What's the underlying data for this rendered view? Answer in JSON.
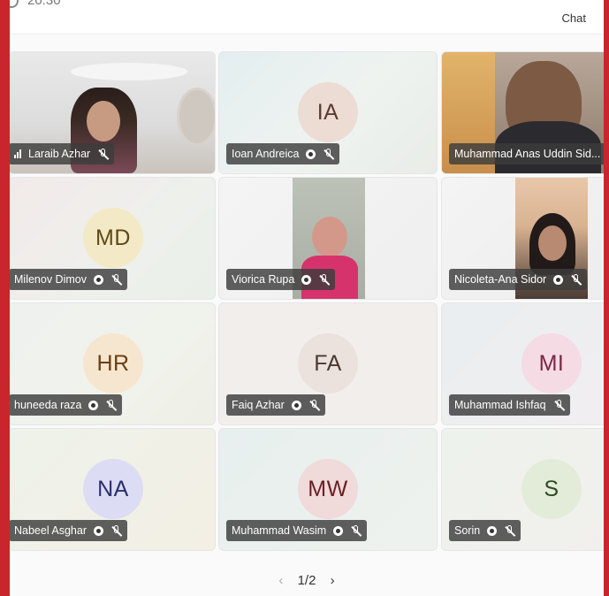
{
  "header": {
    "time": "20:30",
    "chat_label": "Chat"
  },
  "participants": [
    {
      "name": "Laraib Azhar",
      "initials": "",
      "has_video": true
    },
    {
      "name": "Ioan Andreica",
      "initials": "IA",
      "has_video": false
    },
    {
      "name": "Muhammad Anas Uddin Sid...",
      "initials": "",
      "has_video": true
    },
    {
      "name": "Milenov Dimov",
      "initials": "MD",
      "has_video": false
    },
    {
      "name": "Viorica Rupa",
      "initials": "",
      "has_video": true
    },
    {
      "name": "Nicoleta-Ana Sidor",
      "initials": "",
      "has_video": true
    },
    {
      "name": "huneeda raza",
      "initials": "HR",
      "has_video": false
    },
    {
      "name": "Faiq Azhar",
      "initials": "FA",
      "has_video": false
    },
    {
      "name": "Muhammad Ishfaq",
      "initials": "MI",
      "has_video": false
    },
    {
      "name": "Nabeel Asghar",
      "initials": "NA",
      "has_video": false
    },
    {
      "name": "Muhammad Wasim",
      "initials": "MW",
      "has_video": false
    },
    {
      "name": "Sorin",
      "initials": "S",
      "has_video": false
    }
  ],
  "pagination": {
    "current": "1/2",
    "prev_icon": "chevron-left-icon",
    "next_icon": "chevron-right-icon"
  },
  "colors": {
    "frame": "#c8262c",
    "label_bg": "#3c3c3c"
  }
}
